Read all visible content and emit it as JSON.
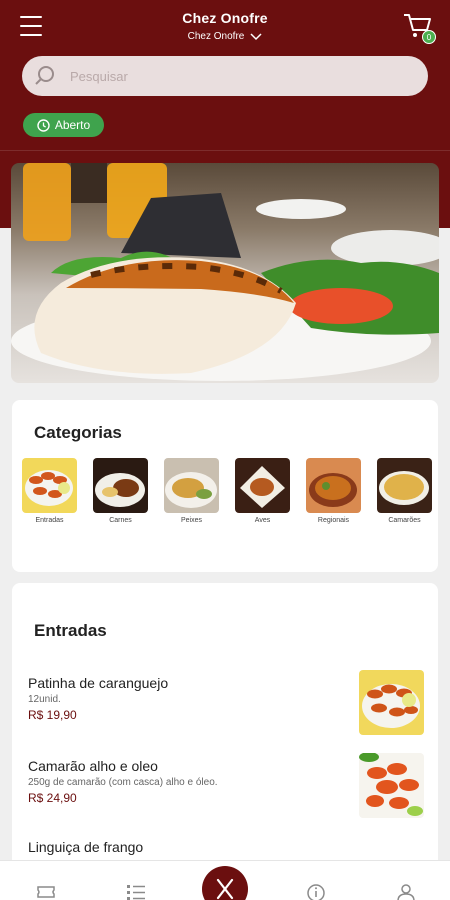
{
  "header": {
    "title": "Chez Onofre",
    "store": "Chez Onofre",
    "cart_count": "0",
    "brand_color": "#6b0f0f"
  },
  "search": {
    "placeholder": "Pesquisar"
  },
  "status": {
    "label": "Aberto",
    "color": "#3fa34d"
  },
  "categories": {
    "title": "Categorias",
    "items": [
      {
        "label": "Entradas",
        "image": "fried-shrimp"
      },
      {
        "label": "Carnes",
        "image": "meat-dish"
      },
      {
        "label": "Peixes",
        "image": "fish-dish"
      },
      {
        "label": "Aves",
        "image": "poultry-dish"
      },
      {
        "label": "Regionais",
        "image": "regional-stew"
      },
      {
        "label": "Camarões",
        "image": "shrimp-risotto"
      }
    ]
  },
  "menu": {
    "section_title": "Entradas",
    "items": [
      {
        "name": "Patinha de caranguejo",
        "description": "12unid.",
        "price": "R$ 19,90",
        "image": "crab-claws"
      },
      {
        "name": "Camarão alho e oleo",
        "description": "250g de camarão (com casca) alho e óleo.",
        "price": "R$ 24,90",
        "image": "garlic-shrimp"
      },
      {
        "name": "Linguiça de frango",
        "description": "",
        "price": ""
      }
    ]
  },
  "bottom_nav": {
    "items": [
      {
        "icon": "ticket-icon"
      },
      {
        "icon": "list-icon"
      },
      {
        "icon": "fork-knife-icon",
        "active": true
      },
      {
        "icon": "info-icon"
      },
      {
        "icon": "user-icon"
      }
    ]
  }
}
